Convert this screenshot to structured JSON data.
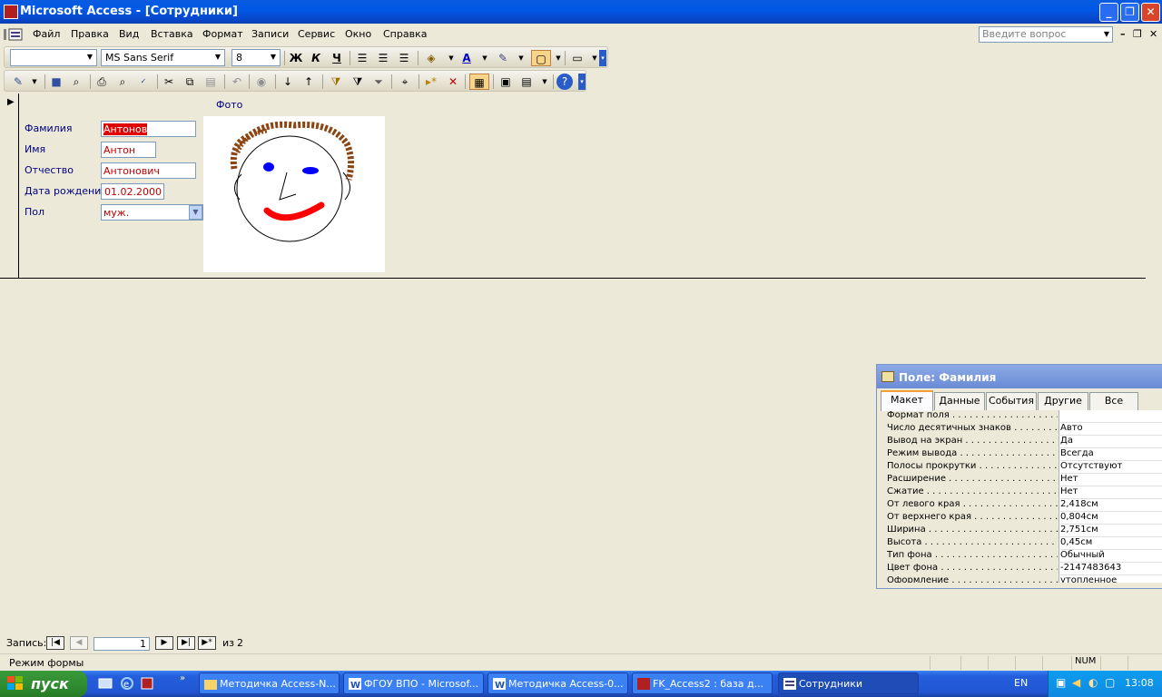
{
  "window": {
    "title": "Microsoft Access - [Сотрудники]"
  },
  "menu": {
    "items": [
      "Файл",
      "Правка",
      "Вид",
      "Вставка",
      "Формат",
      "Записи",
      "Сервис",
      "Окно",
      "Справка"
    ],
    "ask_placeholder": "Введите вопрос"
  },
  "formatting_toolbar": {
    "object_combo": "",
    "font_name": "MS Sans Serif",
    "font_size": "8",
    "bold": "Ж",
    "italic": "К",
    "underline": "Ч"
  },
  "form": {
    "photo_label": "Фото",
    "fields": [
      {
        "label": "Фамилия",
        "value": "Антонов"
      },
      {
        "label": "Имя",
        "value": "Антон"
      },
      {
        "label": "Отчество",
        "value": "Антонович"
      },
      {
        "label": "Дата рождения",
        "value": "01.02.2000"
      },
      {
        "label": "Пол",
        "value": "муж."
      }
    ]
  },
  "navigation": {
    "label": "Запись:",
    "current": "1",
    "of_label": "из",
    "total": "2"
  },
  "status": {
    "mode": "Режим формы",
    "num": "NUM"
  },
  "property_sheet": {
    "title": "Поле: Фамилия",
    "tabs": [
      "Макет",
      "Данные",
      "События",
      "Другие",
      "Все"
    ],
    "active_tab": "Макет",
    "rows": [
      {
        "name": "Формат поля",
        "value": ""
      },
      {
        "name": "Число десятичных знаков",
        "value": "Авто"
      },
      {
        "name": "Вывод на экран",
        "value": "Да"
      },
      {
        "name": "Режим вывода",
        "value": "Всегда"
      },
      {
        "name": "Полосы прокрутки",
        "value": "Отсутствуют"
      },
      {
        "name": "Расширение",
        "value": "Нет"
      },
      {
        "name": "Сжатие",
        "value": "Нет"
      },
      {
        "name": "От левого края",
        "value": "2,418см"
      },
      {
        "name": "От верхнего края",
        "value": "0,804см"
      },
      {
        "name": "Ширина",
        "value": "2,751см"
      },
      {
        "name": "Высота",
        "value": "0,45см"
      },
      {
        "name": "Тип фона",
        "value": "Обычный"
      },
      {
        "name": "Цвет фона",
        "value": "-2147483643"
      },
      {
        "name": "Оформление",
        "value": "утопленное"
      }
    ]
  },
  "taskbar": {
    "start": "пуск",
    "tasks": [
      {
        "label": "Методичка Access-N...",
        "active": false
      },
      {
        "label": "ФГОУ ВПО - Microsof...",
        "active": false
      },
      {
        "label": "Методичка Access-0...",
        "active": false
      },
      {
        "label": "FK_Access2 : база д...",
        "active": false
      },
      {
        "label": "Сотрудники",
        "active": true
      }
    ],
    "language": "EN",
    "clock": "13:08"
  }
}
